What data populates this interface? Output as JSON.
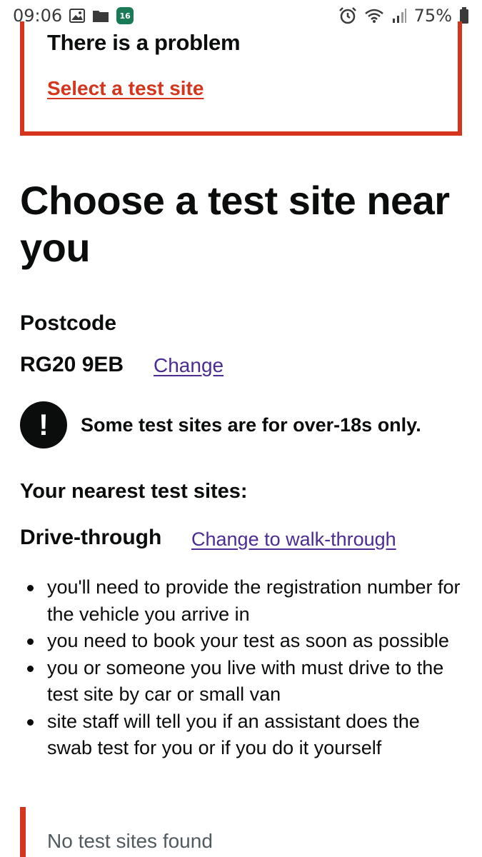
{
  "status_bar": {
    "time": "09:06",
    "calendar_day": "16",
    "battery": "75%"
  },
  "error_summary": {
    "title": "There is a problem",
    "link": "Select a test site"
  },
  "page": {
    "title": "Choose a test site near you",
    "postcode_label": "Postcode",
    "postcode_value": "RG20 9EB",
    "change_label": "Change",
    "warning_icon": "!",
    "warning_text": "Some test sites are for over-18s only.",
    "nearest_heading": "Your nearest test sites:",
    "mode_heading": "Drive-through",
    "change_mode_link": "Change to walk-through",
    "bullets": [
      "you'll need to provide the registration number for the vehicle you arrive in",
      "you need to book your test as soon as possible",
      "you or someone you live with must drive to the test site by car or small van",
      "site staff will tell you if an assistant does the swab test for you or if you do it yourself"
    ],
    "no_sites": "No test sites found"
  },
  "colors": {
    "error_red": "#d4351c",
    "link_purple": "#4c2c92",
    "text": "#0b0c0c",
    "secondary_text": "#505a5f",
    "calendar_green": "#1a7a56"
  }
}
